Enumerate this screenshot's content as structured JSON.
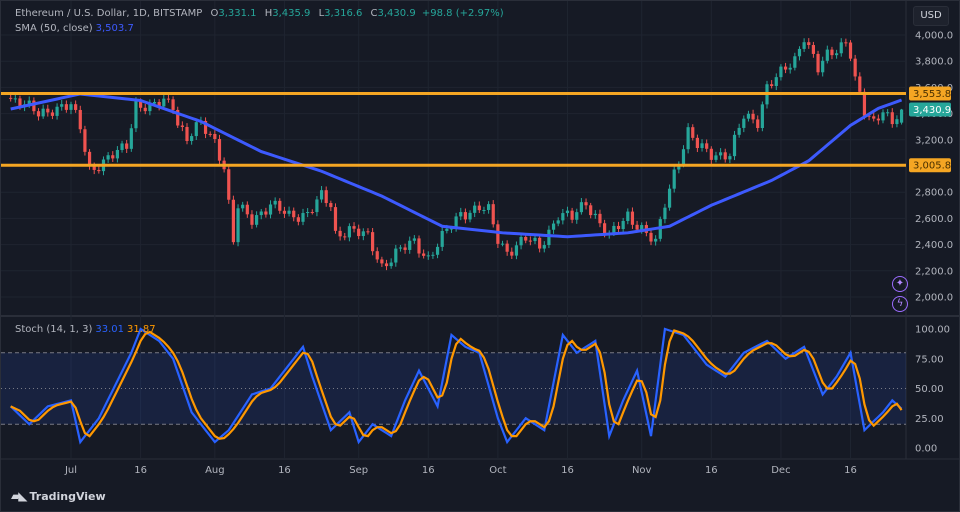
{
  "header": {
    "symbol": "Ethereum / U.S. Dollar, 1D, BITSTAMP",
    "o_label": "O",
    "o": "3,331.1",
    "h_label": "H",
    "h": "3,435.9",
    "l_label": "L",
    "l": "3,316.6",
    "c_label": "C",
    "c": "3,430.9",
    "change": "+98.8 (+2.97%)",
    "sma_label": "SMA (50, close)",
    "sma_value": "3,503.7",
    "stoch_label": "Stoch (14, 1, 3)",
    "stoch_k": "33.01",
    "stoch_d": "31.87",
    "currency_button": "USD"
  },
  "footer": {
    "brand": "TradingView"
  },
  "icons": {
    "ai_icon": "sparkle-icon",
    "alert_icon": "lightning-icon"
  },
  "colors": {
    "up": "#26a69a",
    "down": "#ef5350",
    "sma": "#3d5afe",
    "level": "#f5a623",
    "stoch_k": "#2962ff",
    "stoch_d": "#ff9800",
    "background": "#161a25"
  },
  "chart_data": [
    {
      "type": "candlestick",
      "title": "Ethereum / U.S. Dollar, 1D, BITSTAMP",
      "ylim": [
        1900,
        4100
      ],
      "y_ticks": [
        "2,000.0",
        "2,200.0",
        "2,400.0",
        "2,600.0",
        "2,800.0",
        "3,200.0",
        "3,400.0",
        "3,600.0",
        "3,800.0",
        "4,000.0"
      ],
      "x_ticks": [
        {
          "label": "Jul",
          "date": "Jul 1"
        },
        {
          "label": "16",
          "date": "Jul 16"
        },
        {
          "label": "Aug",
          "date": "Aug 1"
        },
        {
          "label": "16",
          "date": "Aug 16"
        },
        {
          "label": "Sep",
          "date": "Sep 1"
        },
        {
          "label": "16",
          "date": "Sep 16"
        },
        {
          "label": "Oct",
          "date": "Oct 1"
        },
        {
          "label": "16",
          "date": "Oct 16"
        },
        {
          "label": "Nov",
          "date": "Nov 1"
        },
        {
          "label": "16",
          "date": "Nov 16"
        },
        {
          "label": "Dec",
          "date": "Dec 1"
        },
        {
          "label": "16",
          "date": "Dec 16"
        }
      ],
      "close_path": [
        [
          "Jun 18",
          3520
        ],
        [
          "Jun 20",
          3480
        ],
        [
          "Jun 24",
          3400
        ],
        [
          "Jun 27",
          3440
        ],
        [
          "Jul 1",
          3450
        ],
        [
          "Jul 3",
          3300
        ],
        [
          "Jul 5",
          2980
        ],
        [
          "Jul 8",
          3020
        ],
        [
          "Jul 11",
          3100
        ],
        [
          "Jul 13",
          3170
        ],
        [
          "Jul 15",
          3480
        ],
        [
          "Jul 18",
          3430
        ],
        [
          "Jul 21",
          3500
        ],
        [
          "Jul 23",
          3480
        ],
        [
          "Jul 24",
          3340
        ],
        [
          "Jul 26",
          3200
        ],
        [
          "Jul 29",
          3320
        ],
        [
          "Aug 1",
          3200
        ],
        [
          "Aug 3",
          2990
        ],
        [
          "Aug 4",
          2700
        ],
        [
          "Aug 5",
          2420
        ],
        [
          "Aug 6",
          2680
        ],
        [
          "Aug 9",
          2600
        ],
        [
          "Aug 13",
          2700
        ],
        [
          "Aug 17",
          2620
        ],
        [
          "Aug 21",
          2640
        ],
        [
          "Aug 24",
          2760
        ],
        [
          "Aug 26",
          2700
        ],
        [
          "Aug 27",
          2480
        ],
        [
          "Aug 30",
          2520
        ],
        [
          "Sep 3",
          2450
        ],
        [
          "Sep 6",
          2240
        ],
        [
          "Sep 9",
          2330
        ],
        [
          "Sep 13",
          2420
        ],
        [
          "Sep 16",
          2300
        ],
        [
          "Sep 19",
          2450
        ],
        [
          "Sep 23",
          2640
        ],
        [
          "Sep 27",
          2680
        ],
        [
          "Sep 29",
          2650
        ],
        [
          "Oct 1",
          2440
        ],
        [
          "Oct 3",
          2350
        ],
        [
          "Oct 7",
          2440
        ],
        [
          "Oct 10",
          2380
        ],
        [
          "Oct 14",
          2630
        ],
        [
          "Oct 17",
          2600
        ],
        [
          "Oct 20",
          2730
        ],
        [
          "Oct 22",
          2620
        ],
        [
          "Oct 25",
          2450
        ],
        [
          "Oct 29",
          2630
        ],
        [
          "Nov 1",
          2520
        ],
        [
          "Nov 4",
          2400
        ],
        [
          "Nov 6",
          2720
        ],
        [
          "Nov 8",
          2960
        ],
        [
          "Nov 11",
          3250
        ],
        [
          "Nov 13",
          3150
        ],
        [
          "Nov 16",
          3100
        ],
        [
          "Nov 20",
          3080
        ],
        [
          "Nov 23",
          3380
        ],
        [
          "Nov 26",
          3350
        ],
        [
          "Nov 28",
          3600
        ],
        [
          "Dec 1",
          3700
        ],
        [
          "Dec 4",
          3820
        ],
        [
          "Dec 6",
          4000
        ],
        [
          "Dec 9",
          3730
        ],
        [
          "Dec 11",
          3840
        ],
        [
          "Dec 13",
          3900
        ],
        [
          "Dec 15",
          3960
        ],
        [
          "Dec 16",
          3860
        ],
        [
          "Dec 17",
          3650
        ],
        [
          "Dec 19",
          3400
        ],
        [
          "Dec 21",
          3330
        ],
        [
          "Dec 23",
          3450
        ],
        [
          "Dec 25",
          3330
        ],
        [
          "Dec 27",
          3430.9
        ]
      ],
      "last_candle": {
        "date": "Dec 27",
        "open": 3331.1,
        "high": 3435.9,
        "low": 3316.6,
        "close": 3430.9
      },
      "sma50": [
        [
          "Jun 18",
          3435
        ],
        [
          "Jul 3",
          3550
        ],
        [
          "Jul 16",
          3500
        ],
        [
          "Jul 29",
          3340
        ],
        [
          "Aug 11",
          3110
        ],
        [
          "Aug 24",
          2960
        ],
        [
          "Sep 6",
          2770
        ],
        [
          "Sep 19",
          2540
        ],
        [
          "Oct 2",
          2490
        ],
        [
          "Oct 16",
          2460
        ],
        [
          "Oct 29",
          2490
        ],
        [
          "Nov 7",
          2540
        ],
        [
          "Nov 16",
          2700
        ],
        [
          "Nov 29",
          2890
        ],
        [
          "Dec 7",
          3040
        ],
        [
          "Dec 16",
          3310
        ],
        [
          "Dec 22",
          3440
        ],
        [
          "Dec 27",
          3503.7
        ]
      ],
      "levels": [
        {
          "value": 3553.8,
          "label": "3,553.8"
        },
        {
          "value": 3005.8,
          "label": "3,005.8"
        }
      ],
      "last_price_label": "3,430.9"
    },
    {
      "type": "line",
      "title": "Stoch (14, 1, 3)",
      "ylim": [
        0,
        100
      ],
      "y_ticks": [
        "100.00",
        "75.00",
        "50.00",
        "25.00",
        "0.00"
      ],
      "bands": [
        20,
        50,
        80
      ],
      "series": [
        {
          "name": "%K",
          "last": 33.01,
          "points": [
            [
              "Jun 18",
              35
            ],
            [
              "Jun 22",
              20
            ],
            [
              "Jun 26",
              35
            ],
            [
              "Jul 1",
              40
            ],
            [
              "Jul 3",
              5
            ],
            [
              "Jul 7",
              25
            ],
            [
              "Jul 14",
              80
            ],
            [
              "Jul 16",
              100
            ],
            [
              "Jul 20",
              90
            ],
            [
              "Jul 23",
              75
            ],
            [
              "Jul 27",
              30
            ],
            [
              "Aug 1",
              5
            ],
            [
              "Aug 4",
              15
            ],
            [
              "Aug 9",
              45
            ],
            [
              "Aug 13",
              50
            ],
            [
              "Aug 17",
              70
            ],
            [
              "Aug 20",
              85
            ],
            [
              "Aug 22",
              60
            ],
            [
              "Aug 26",
              15
            ],
            [
              "Aug 30",
              30
            ],
            [
              "Sep 1",
              5
            ],
            [
              "Sep 4",
              20
            ],
            [
              "Sep 8",
              10
            ],
            [
              "Sep 11",
              40
            ],
            [
              "Sep 14",
              65
            ],
            [
              "Sep 18",
              35
            ],
            [
              "Sep 21",
              95
            ],
            [
              "Sep 24",
              85
            ],
            [
              "Sep 27",
              80
            ],
            [
              "Oct 1",
              25
            ],
            [
              "Oct 3",
              5
            ],
            [
              "Oct 7",
              25
            ],
            [
              "Oct 11",
              15
            ],
            [
              "Oct 15",
              95
            ],
            [
              "Oct 18",
              80
            ],
            [
              "Oct 22",
              90
            ],
            [
              "Oct 25",
              10
            ],
            [
              "Oct 28",
              40
            ],
            [
              "Oct 31",
              65
            ],
            [
              "Nov 3",
              10
            ],
            [
              "Nov 6",
              100
            ],
            [
              "Nov 10",
              95
            ],
            [
              "Nov 15",
              70
            ],
            [
              "Nov 19",
              60
            ],
            [
              "Nov 23",
              80
            ],
            [
              "Nov 28",
              90
            ],
            [
              "Dec 2",
              75
            ],
            [
              "Dec 6",
              85
            ],
            [
              "Dec 10",
              45
            ],
            [
              "Dec 13",
              60
            ],
            [
              "Dec 16",
              80
            ],
            [
              "Dec 19",
              15
            ],
            [
              "Dec 23",
              30
            ],
            [
              "Dec 25",
              40
            ],
            [
              "Dec 27",
              33.01
            ]
          ]
        },
        {
          "name": "%D",
          "last": 31.87
        }
      ]
    }
  ]
}
